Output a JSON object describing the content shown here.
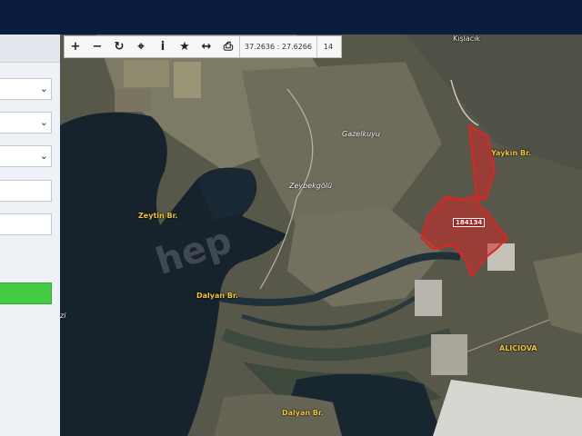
{
  "toolbar": {
    "zoom_in": "+",
    "zoom_out": "−",
    "refresh": "↻",
    "locate": "⌖",
    "info": "i",
    "favorite": "★",
    "measure": "↔",
    "print": "⎙",
    "coordinates": "37.2636 : 27.6266",
    "zoom_level": "14"
  },
  "map": {
    "places": [
      {
        "name": "Kışlacık"
      },
      {
        "name": "Gazelkuyu"
      },
      {
        "name": "Yaykın Br."
      },
      {
        "name": "Zeybekgölü"
      },
      {
        "name": "Zeytin Br."
      },
      {
        "name": "Dalyan Br."
      },
      {
        "name": "ALICIOVA"
      },
      {
        "name": "Dalyan Br."
      },
      {
        "name": "zi"
      }
    ],
    "parcel_id": "184134",
    "watermark": "hep"
  },
  "colors": {
    "topbar": "#0a1d3e",
    "parcel": "#d42a2a",
    "label": "#f2c63a",
    "action_button": "#44cc44"
  }
}
